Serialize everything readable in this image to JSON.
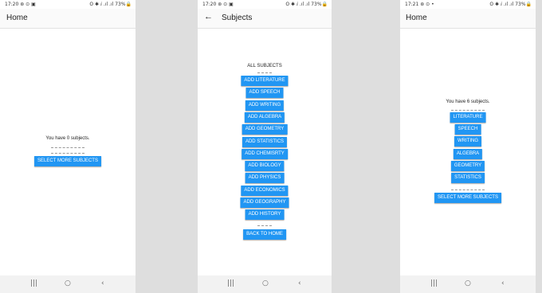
{
  "screens": [
    {
      "status": {
        "time": "17:20",
        "left_icons": "⊛ ⊙ ▣",
        "right": "ʘ ✱ ⅈ .ıl .ıl 73%🔒"
      },
      "title": "Home",
      "message": "You have 0 subjects.",
      "select_button": "SELECT MORE SUBJECTS"
    },
    {
      "status": {
        "time": "17:20",
        "left_icons": "⊛ ⊙ ▣",
        "right": "ʘ ✱ ⅈ .ıl .ıl 73%🔒"
      },
      "title": "Subjects",
      "heading": "ALL SUBJECTS",
      "add_buttons": [
        "ADD LITERATURE",
        "ADD SPEECH",
        "ADD WRITING",
        "ADD ALGEBRA",
        "ADD GEOMETRY",
        "ADD STATISTICS",
        "ADD CHEMISRTY",
        "ADD BIOLOGY",
        "ADD PHYSICS",
        "ADD ECONOMICS",
        "ADD GEOGRAPHY",
        "ADD HISTORY"
      ],
      "back_button": "BACK TO HOME"
    },
    {
      "status": {
        "time": "17:21",
        "left_icons": "⊛ ⊙ •",
        "right": "ʘ ✱ ⅈ .ıl .ıl 73%🔒"
      },
      "title": "Home",
      "message": "You have 6 subjects.",
      "subjects": [
        "LITERATURE",
        "SPEECH",
        "WRITING",
        "ALGEBRA",
        "GEOMETRY",
        "STATISTICS"
      ],
      "select_button": "SELECT MORE SUBJECTS"
    }
  ],
  "navbar": {
    "recents": "|||",
    "home": "○",
    "back": "‹"
  },
  "icons": {
    "back_arrow": "←"
  },
  "colors": {
    "button": "#2196f3",
    "button_text": "#ffffff",
    "background": "#dedede"
  }
}
